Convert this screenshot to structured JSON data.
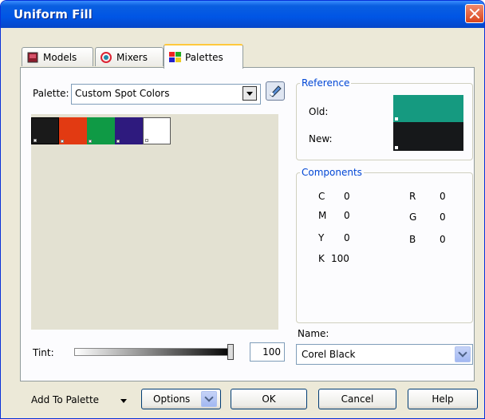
{
  "window": {
    "title": "Uniform Fill"
  },
  "tabs": [
    {
      "label": "Models"
    },
    {
      "label": "Mixers"
    },
    {
      "label": "Palettes"
    }
  ],
  "palette": {
    "label": "Palette:",
    "value": "Custom Spot Colors",
    "swatches": [
      {
        "color": "#1A1A1A"
      },
      {
        "color": "#E23A12"
      },
      {
        "color": "#0F9A45"
      },
      {
        "color": "#2E1A7E"
      },
      {
        "color": "#FFFFFF"
      }
    ]
  },
  "reference": {
    "title": "Reference",
    "old_label": "Old:",
    "new_label": "New:",
    "old_color": "#159A80",
    "new_color": "#16181A"
  },
  "components": {
    "title": "Components",
    "c_label": "C",
    "c_value": "0",
    "m_label": "M",
    "m_value": "0",
    "y_label": "Y",
    "y_value": "0",
    "k_label": "K",
    "k_value": "100",
    "r_label": "R",
    "r_value": "0",
    "g_label": "G",
    "g_value": "0",
    "b_label": "B",
    "b_value": "0"
  },
  "name": {
    "label": "Name:",
    "value": "Corel Black"
  },
  "tint": {
    "label": "Tint:",
    "value": "100"
  },
  "buttons": {
    "add_to_palette": "Add To Palette",
    "options": "Options",
    "ok": "OK",
    "cancel": "Cancel",
    "help": "Help"
  }
}
